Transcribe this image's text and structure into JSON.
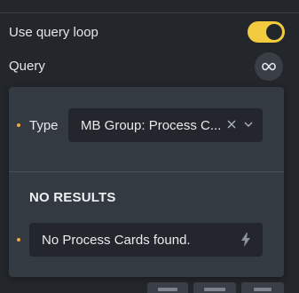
{
  "settings": {
    "use_query_loop": {
      "label": "Use query loop",
      "enabled": true
    },
    "query": {
      "label": "Query",
      "icon": "infinity-icon"
    }
  },
  "popover": {
    "type_label": "Type",
    "type_value": "MB Group: Process C...",
    "no_results_heading": "NO RESULTS",
    "result_text": "No Process Cards found."
  },
  "colors": {
    "accent": "#f2cc3e",
    "indicator": "#f2a93b",
    "panel_bg": "#23262b",
    "popover_bg": "#343a42"
  }
}
